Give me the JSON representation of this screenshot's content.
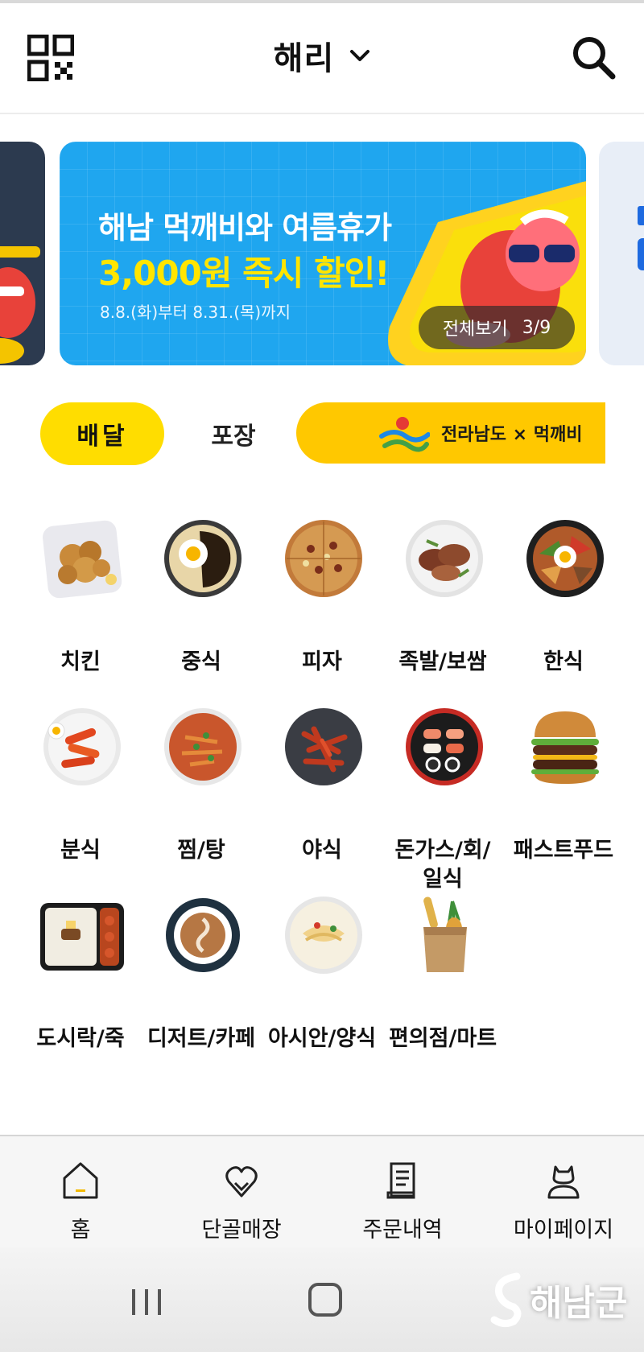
{
  "header": {
    "title": "해리",
    "qr_icon": "qr-code-icon",
    "search_icon": "search-icon",
    "chevron_icon": "chevron-down-icon"
  },
  "banner": {
    "line1": "해남 먹깨비와 여름휴가",
    "line2": "3,000원 즉시 할인!",
    "line3": "8.8.(화)부터 8.31.(목)까지",
    "view_all": "전체보기",
    "counter": "3/9",
    "bg_color": "#1fa6ef",
    "highlight_color": "#ffe500"
  },
  "tabs": {
    "delivery": "배달",
    "pickup": "포장",
    "promo": "전라남도 × 먹깨비",
    "accent": "#ffdd00"
  },
  "categories": [
    {
      "label": "치킨",
      "icon": "fried-chicken-icon"
    },
    {
      "label": "중식",
      "icon": "jajangmyeon-icon"
    },
    {
      "label": "피자",
      "icon": "pizza-icon"
    },
    {
      "label": "족발/보쌈",
      "icon": "jokbal-icon"
    },
    {
      "label": "한식",
      "icon": "bibimbap-icon"
    },
    {
      "label": "분식",
      "icon": "tteokbokki-icon"
    },
    {
      "label": "찜/탕",
      "icon": "stew-icon"
    },
    {
      "label": "야식",
      "icon": "spicy-snack-icon"
    },
    {
      "label": "돈가스/회/일식",
      "label_line1": "돈가스/회/",
      "label_line2": "일식",
      "icon": "sushi-icon"
    },
    {
      "label": "패스트푸드",
      "icon": "burger-icon"
    },
    {
      "label": "도시락/죽",
      "icon": "lunchbox-icon"
    },
    {
      "label": "디저트/카페",
      "icon": "latte-icon"
    },
    {
      "label": "아시안/양식",
      "icon": "pasta-icon"
    },
    {
      "label": "편의점/마트",
      "icon": "grocery-bag-icon"
    }
  ],
  "bottom_nav": [
    {
      "label": "홈",
      "icon": "home-icon"
    },
    {
      "label": "단골매장",
      "icon": "heart-hand-icon"
    },
    {
      "label": "주문내역",
      "icon": "receipt-icon"
    },
    {
      "label": "마이페이지",
      "icon": "profile-icon"
    }
  ],
  "watermark": "해남군"
}
